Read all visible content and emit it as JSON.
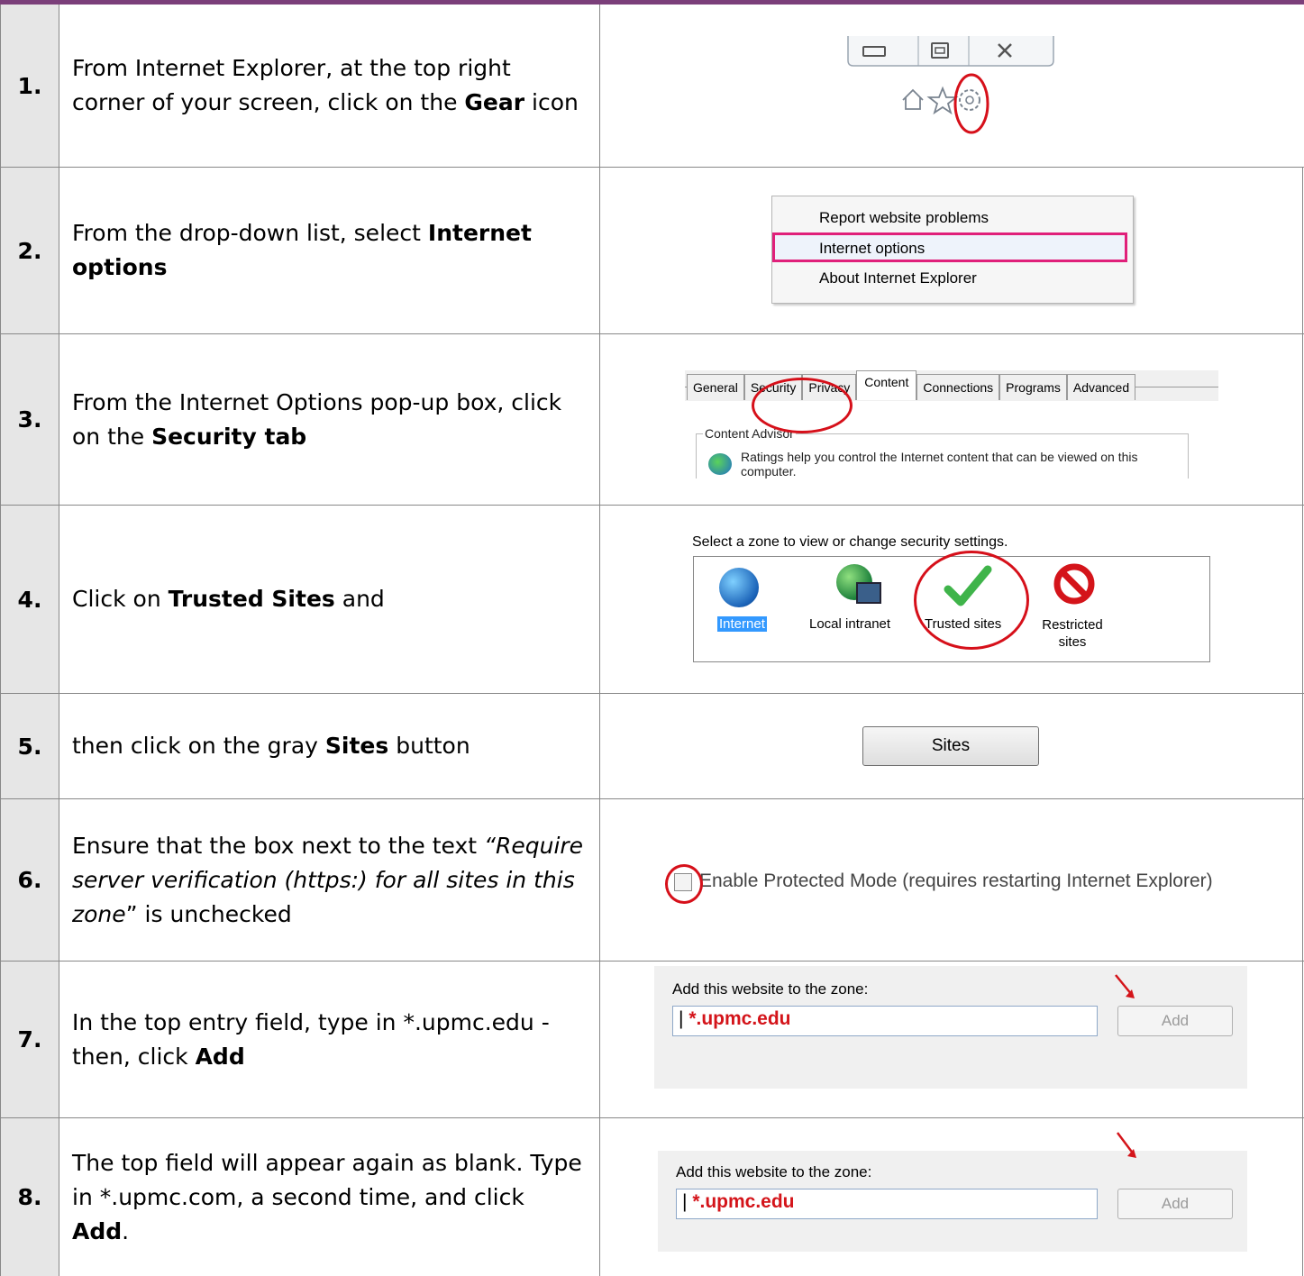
{
  "steps": [
    {
      "num": "1.",
      "text": [
        "From Internet Explorer, at the top right corner of your screen, click on the ",
        "Gear",
        " icon"
      ]
    },
    {
      "num": "2.",
      "text": [
        "From the drop-down list, select ",
        "Internet options"
      ]
    },
    {
      "num": "3.",
      "text": [
        "From the Internet Options pop-up box, click on the ",
        "Security tab"
      ]
    },
    {
      "num": "4.",
      "text": [
        "Click on ",
        "Trusted Sites",
        " and"
      ]
    },
    {
      "num": "5.",
      "text": [
        "then click on the gray ",
        "Sites",
        " button"
      ]
    },
    {
      "num": "6.",
      "text": [
        "Ensure that the box next to the text ",
        "“Require server verification (https:) for all sites in this zone",
        "” is unchecked"
      ]
    },
    {
      "num": "7.",
      "text": [
        "In the top entry field, type in ",
        "*.upmc.edu",
        " - then, click ",
        "Add"
      ]
    },
    {
      "num": "8.",
      "text": [
        "The top field will appear again as blank. Type in  ",
        "*.upmc.com",
        ", a second time, and click ",
        "Add",
        "."
      ]
    }
  ],
  "shot1": {
    "icons": [
      "minimize-icon",
      "restore-icon",
      "close-icon",
      "home-icon",
      "star-icon",
      "gear-icon"
    ]
  },
  "shot2": {
    "menu": [
      "Report website problems",
      "Internet options",
      "About Internet Explorer"
    ]
  },
  "shot3": {
    "tabs": [
      "General",
      "Security",
      "Privacy",
      "Content",
      "Connections",
      "Programs",
      "Advanced"
    ],
    "group": "Content Advisor",
    "desc": "Ratings help you control the Internet content that can be viewed on this computer."
  },
  "shot4": {
    "heading": "Select a zone to view or change security settings.",
    "zones": [
      "Internet",
      "Local intranet",
      "Trusted sites",
      "Restricted sites"
    ]
  },
  "shot5": {
    "button": "Sites"
  },
  "shot6": {
    "label": "Enable Protected Mode (requires restarting Internet Explorer)"
  },
  "shot7": {
    "label": "Add this website to the zone:",
    "value": "*.upmc.edu",
    "button": "Add"
  },
  "shot8": {
    "label": "Add this website to the zone:",
    "value": "*.upmc.edu",
    "button": "Add"
  },
  "colors": {
    "accent_bar": "#7b3f7a",
    "annotation_red": "#d6101a",
    "highlight_pink": "#e0207a",
    "selection_blue": "#3399ff"
  }
}
